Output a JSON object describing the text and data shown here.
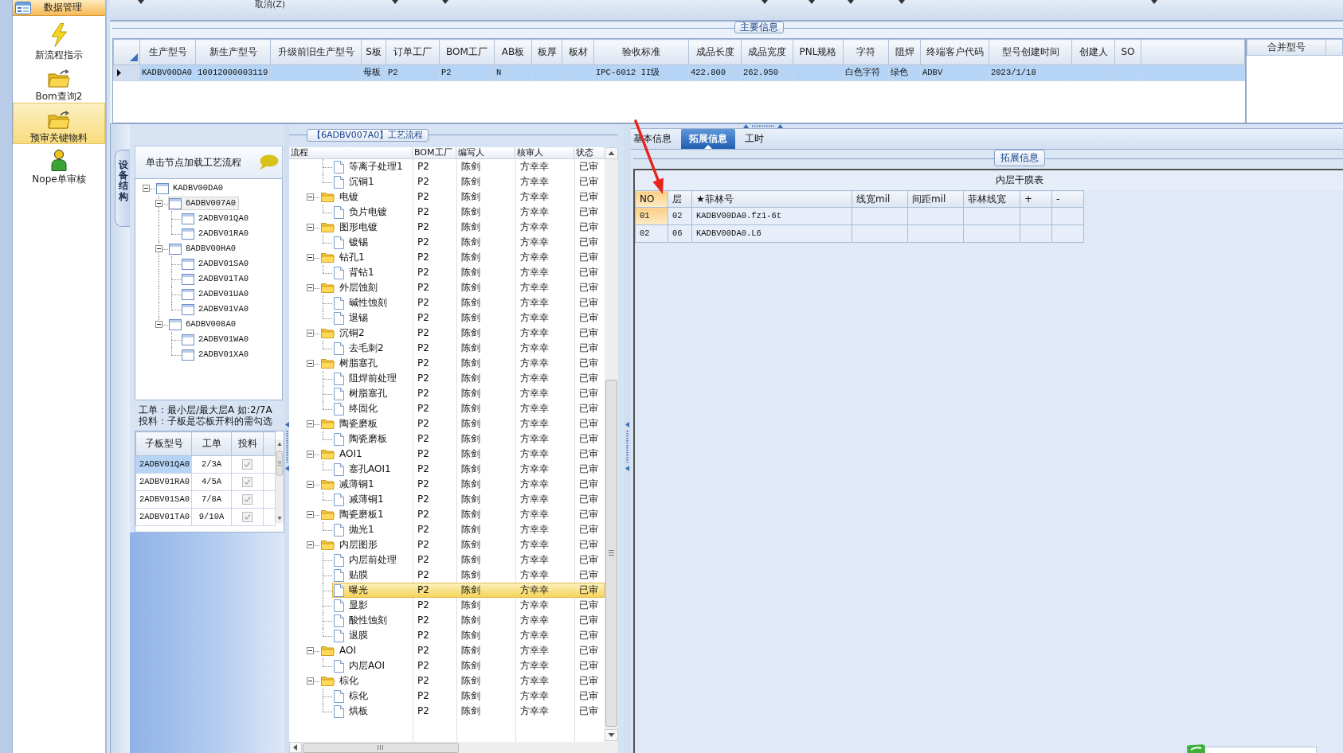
{
  "toolbar": {
    "items": [
      {
        "kind": "dropdown"
      },
      {
        "kind": "button",
        "label": "取消(Z)"
      },
      {
        "kind": "dropdown"
      },
      {
        "kind": "dropdown"
      },
      {
        "kind": "dropdown"
      },
      {
        "kind": "dropdown"
      },
      {
        "kind": "dropdown"
      },
      {
        "kind": "dropdown"
      },
      {
        "kind": "dropdown"
      }
    ]
  },
  "nav": {
    "header": "数据管理",
    "items": [
      {
        "label": "新流程指示",
        "selected": false
      },
      {
        "label": "Bom查询2",
        "selected": false
      },
      {
        "label": "预审关键物料",
        "selected": true
      },
      {
        "label": "Nope单审核",
        "selected": false
      }
    ]
  },
  "main_info": {
    "title": "主要信息",
    "columns": [
      "生产型号",
      "新生产型号",
      "升级前旧生产型号",
      "S板",
      "订单工厂",
      "BOM工厂",
      "AB板",
      "板厚",
      "板材",
      "验收标准",
      "成品长度",
      "成品宽度",
      "PNL规格",
      "字符",
      "阻焊",
      "终端客户代码",
      "型号创建时间",
      "创建人",
      "SO"
    ],
    "rows": [
      {
        "current": true,
        "selected": true,
        "cells": [
          "KADBV00DA0",
          "10012000003119",
          null,
          "母板",
          "P2",
          "P2",
          "N",
          null,
          null,
          "IPC-6012 II级",
          "422.800",
          "262.950",
          null,
          "白色字符",
          "绿色",
          "ADBV",
          "2023/1/18"
        ]
      }
    ]
  },
  "merge_table": {
    "columns": [
      "合并型号"
    ]
  },
  "structure": {
    "tab": "设备结构",
    "hint": "单击节点加载工艺流程",
    "tree": [
      {
        "label": "KADBV00DA0",
        "expanded": true,
        "selected": false,
        "children": [
          {
            "label": "6ADBV007A0",
            "expanded": true,
            "selected": true,
            "children": [
              {
                "label": "2ADBV01QA0",
                "selected": false
              },
              {
                "label": "2ADBV01RA0",
                "selected": false
              }
            ]
          },
          {
            "label": "8ADBV00HA0",
            "expanded": true,
            "selected": false,
            "children": [
              {
                "label": "2ADBV01SA0",
                "selected": false
              },
              {
                "label": "2ADBV01TA0",
                "selected": false
              },
              {
                "label": "2ADBV01UA0",
                "selected": false
              },
              {
                "label": "2ADBV01VA0",
                "selected": false
              }
            ]
          },
          {
            "label": "6ADBV008A0",
            "expanded": true,
            "selected": false,
            "children": [
              {
                "label": "2ADBV01WA0",
                "selected": false
              },
              {
                "label": "2ADBV01XA0",
                "selected": false
              }
            ]
          }
        ]
      }
    ],
    "notes": [
      "工单：最小层/最大层A 如:2/7A",
      "投料：子板是芯板开料的需勾选"
    ],
    "sub_boards": {
      "columns": [
        "子板型号",
        "工单",
        "投料"
      ],
      "rows": [
        {
          "board": "2ADBV01QA0",
          "order": "2/3A",
          "checked": true,
          "disabled": true,
          "selected": true
        },
        {
          "board": "2ADBV01RA0",
          "order": "4/5A",
          "checked": true,
          "disabled": true,
          "selected": false
        },
        {
          "board": "2ADBV01SA0",
          "order": "7/8A",
          "checked": true,
          "disabled": true,
          "selected": false
        },
        {
          "board": "2ADBV01TA0",
          "order": "9/10A",
          "checked": true,
          "disabled": true,
          "selected": false
        }
      ]
    }
  },
  "flow": {
    "title": "【6ADBV007A0】工艺流程",
    "columns": [
      "流程",
      "BOM工厂",
      "编写人",
      "核审人",
      "状态"
    ],
    "rows": [
      {
        "children": [
          {
            "step": "等离子处理1",
            "bom_factory": "P2",
            "writer": "陈剑",
            "reviewer": "方幸幸",
            "status": "已审",
            "selected": false
          },
          {
            "step": "沉铜1",
            "bom_factory": "P2",
            "writer": "陈剑",
            "reviewer": "方幸幸",
            "status": "已审",
            "selected": false
          }
        ]
      },
      {
        "step": "电镀",
        "bom_factory": "P2",
        "writer": "陈剑",
        "reviewer": "方幸幸",
        "status": "已审",
        "selected": false,
        "expanded": true,
        "children": [
          {
            "step": "负片电镀",
            "bom_factory": "P2",
            "writer": "陈剑",
            "reviewer": "方幸幸",
            "status": "已审",
            "selected": false
          }
        ]
      },
      {
        "step": "图形电镀",
        "bom_factory": "P2",
        "writer": "陈剑",
        "reviewer": "方幸幸",
        "status": "已审",
        "selected": false,
        "expanded": true,
        "children": [
          {
            "step": "镀锡",
            "bom_factory": "P2",
            "writer": "陈剑",
            "reviewer": "方幸幸",
            "status": "已审",
            "selected": false
          }
        ]
      },
      {
        "step": "钻孔1",
        "bom_factory": "P2",
        "writer": "陈剑",
        "reviewer": "方幸幸",
        "status": "已审",
        "selected": false,
        "expanded": true,
        "children": [
          {
            "step": "背钻1",
            "bom_factory": "P2",
            "writer": "陈剑",
            "reviewer": "方幸幸",
            "status": "已审",
            "selected": false
          }
        ]
      },
      {
        "step": "外层蚀刻",
        "bom_factory": "P2",
        "writer": "陈剑",
        "reviewer": "方幸幸",
        "status": "已审",
        "selected": false,
        "expanded": true,
        "children": [
          {
            "step": "碱性蚀刻",
            "bom_factory": "P2",
            "writer": "陈剑",
            "reviewer": "方幸幸",
            "status": "已审",
            "selected": false
          },
          {
            "step": "退锡",
            "bom_factory": "P2",
            "writer": "陈剑",
            "reviewer": "方幸幸",
            "status": "已审",
            "selected": false
          }
        ]
      },
      {
        "step": "沉铜2",
        "bom_factory": "P2",
        "writer": "陈剑",
        "reviewer": "方幸幸",
        "status": "已审",
        "selected": false,
        "expanded": true,
        "children": [
          {
            "step": "去毛刺2",
            "bom_factory": "P2",
            "writer": "陈剑",
            "reviewer": "方幸幸",
            "status": "已审",
            "selected": false
          }
        ]
      },
      {
        "step": "树脂塞孔",
        "bom_factory": "P2",
        "writer": "陈剑",
        "reviewer": "方幸幸",
        "status": "已审",
        "selected": false,
        "expanded": true,
        "children": [
          {
            "step": "阻焊前处理",
            "bom_factory": "P2",
            "writer": "陈剑",
            "reviewer": "方幸幸",
            "status": "已审",
            "selected": false
          },
          {
            "step": "树脂塞孔",
            "bom_factory": "P2",
            "writer": "陈剑",
            "reviewer": "方幸幸",
            "status": "已审",
            "selected": false
          },
          {
            "step": "终固化",
            "bom_factory": "P2",
            "writer": "陈剑",
            "reviewer": "方幸幸",
            "status": "已审",
            "selected": false
          }
        ]
      },
      {
        "step": "陶瓷磨板",
        "bom_factory": "P2",
        "writer": "陈剑",
        "reviewer": "方幸幸",
        "status": "已审",
        "selected": false,
        "expanded": true,
        "children": [
          {
            "step": "陶瓷磨板",
            "bom_factory": "P2",
            "writer": "陈剑",
            "reviewer": "方幸幸",
            "status": "已审",
            "selected": false
          }
        ]
      },
      {
        "step": "AOI1",
        "bom_factory": "P2",
        "writer": "陈剑",
        "reviewer": "方幸幸",
        "status": "已审",
        "selected": false,
        "expanded": true,
        "children": [
          {
            "step": "塞孔AOI1",
            "bom_factory": "P2",
            "writer": "陈剑",
            "reviewer": "方幸幸",
            "status": "已审",
            "selected": false
          }
        ]
      },
      {
        "step": "减薄铜1",
        "bom_factory": "P2",
        "writer": "陈剑",
        "reviewer": "方幸幸",
        "status": "已审",
        "selected": false,
        "expanded": true,
        "children": [
          {
            "step": "减薄铜1",
            "bom_factory": "P2",
            "writer": "陈剑",
            "reviewer": "方幸幸",
            "status": "已审",
            "selected": false
          }
        ]
      },
      {
        "step": "陶瓷磨板1",
        "bom_factory": "P2",
        "writer": "陈剑",
        "reviewer": "方幸幸",
        "status": "已审",
        "selected": false,
        "expanded": true,
        "children": [
          {
            "step": "抛光1",
            "bom_factory": "P2",
            "writer": "陈剑",
            "reviewer": "方幸幸",
            "status": "已审",
            "selected": false
          }
        ]
      },
      {
        "step": "内层图形",
        "bom_factory": "P2",
        "writer": "陈剑",
        "reviewer": "方幸幸",
        "status": "已审",
        "selected": false,
        "expanded": true,
        "children": [
          {
            "step": "内层前处理",
            "bom_factory": "P2",
            "writer": "陈剑",
            "reviewer": "方幸幸",
            "status": "已审",
            "selected": false
          },
          {
            "step": "贴膜",
            "bom_factory": "P2",
            "writer": "陈剑",
            "reviewer": "方幸幸",
            "status": "已审",
            "selected": false
          },
          {
            "step": "曝光",
            "bom_factory": "P2",
            "writer": "陈剑",
            "reviewer": "方幸幸",
            "status": "已审",
            "selected": true
          },
          {
            "step": "显影",
            "bom_factory": "P2",
            "writer": "陈剑",
            "reviewer": "方幸幸",
            "status": "已审",
            "selected": false
          },
          {
            "step": "酸性蚀刻",
            "bom_factory": "P2",
            "writer": "陈剑",
            "reviewer": "方幸幸",
            "status": "已审",
            "selected": false
          },
          {
            "step": "退膜",
            "bom_factory": "P2",
            "writer": "陈剑",
            "reviewer": "方幸幸",
            "status": "已审",
            "selected": false
          }
        ]
      },
      {
        "step": "AOI",
        "bom_factory": "P2",
        "writer": "陈剑",
        "reviewer": "方幸幸",
        "status": "已审",
        "selected": false,
        "expanded": true,
        "children": [
          {
            "step": "内层AOI",
            "bom_factory": "P2",
            "writer": "陈剑",
            "reviewer": "方幸幸",
            "status": "已审",
            "selected": false
          }
        ]
      },
      {
        "step": "棕化",
        "bom_factory": "P2",
        "writer": "陈剑",
        "reviewer": "方幸幸",
        "status": "已审",
        "selected": false,
        "expanded": true,
        "children": [
          {
            "step": "棕化",
            "bom_factory": "P2",
            "writer": "陈剑",
            "reviewer": "方幸幸",
            "status": "已审",
            "selected": false
          },
          {
            "step": "烘板",
            "bom_factory": "P2",
            "writer": "陈剑",
            "reviewer": "方幸幸",
            "status": "已审",
            "selected": false
          }
        ]
      }
    ]
  },
  "tabs": [
    {
      "label": "基本信息",
      "selected": false
    },
    {
      "label": "拓展信息",
      "selected": true
    },
    {
      "label": "工时",
      "selected": false
    }
  ],
  "extension": {
    "title": "拓展信息",
    "grid_title": "内层干膜表",
    "columns": [
      "NO",
      "层",
      "★菲林号",
      "线宽mil",
      "间距mil",
      "菲林线宽",
      "+",
      "-"
    ],
    "rows": [
      {
        "cells": [
          "01",
          "02",
          "KADBV00DA0.fz1-6t"
        ],
        "selected": true
      },
      {
        "cells": [
          "02",
          "06",
          "KADBV00DA0.L6"
        ],
        "selected": false
      }
    ]
  }
}
